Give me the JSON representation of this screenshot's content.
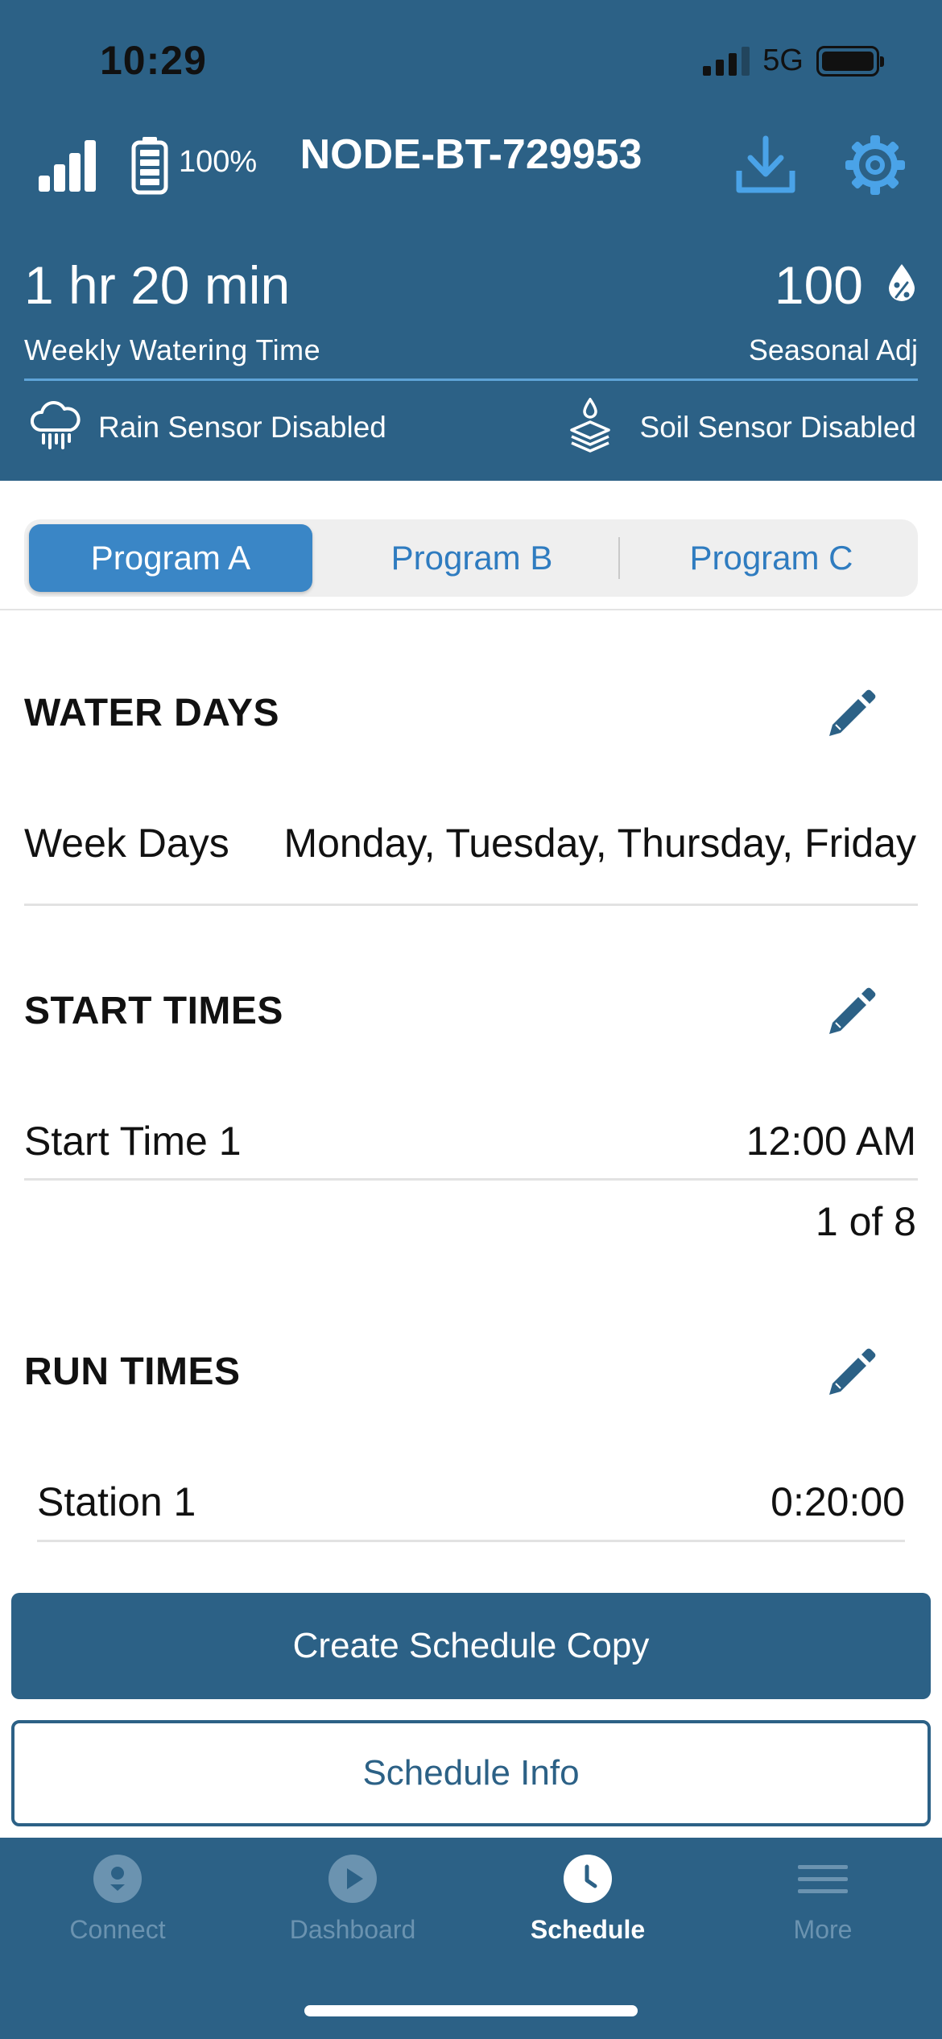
{
  "status_bar": {
    "time": "10:29",
    "network": "5G"
  },
  "header": {
    "device_name": "NODE-BT-729953",
    "battery_percent": "100%",
    "weekly_watering_time": "1 hr 20 min",
    "weekly_watering_label": "Weekly Watering Time",
    "seasonal_adj_value": "100",
    "seasonal_adj_label": "Seasonal Adj",
    "rain_sensor": "Rain Sensor Disabled",
    "soil_sensor": "Soil Sensor Disabled"
  },
  "programs": {
    "tabs": [
      "Program A",
      "Program B",
      "Program C"
    ],
    "selected": "Program A"
  },
  "water_days": {
    "title": "WATER DAYS",
    "label": "Week Days",
    "value": "Monday, Tuesday, Thursday, Friday"
  },
  "start_times": {
    "title": "START TIMES",
    "items": [
      {
        "label": "Start Time 1",
        "value": "12:00 AM"
      }
    ],
    "count": "1 of 8"
  },
  "run_times": {
    "title": "RUN TIMES",
    "items": [
      {
        "label": "Station 1",
        "value": "0:20:00"
      }
    ]
  },
  "actions": {
    "copy_label": "Create Schedule Copy",
    "info_label": "Schedule Info"
  },
  "nav": {
    "items": [
      {
        "label": "Connect",
        "icon": "connect-icon"
      },
      {
        "label": "Dashboard",
        "icon": "play-icon"
      },
      {
        "label": "Schedule",
        "icon": "clock-icon"
      },
      {
        "label": "More",
        "icon": "menu-icon"
      }
    ],
    "active": "Schedule"
  },
  "colors": {
    "header_bg": "#2c6186",
    "accent_blue": "#3a86c6",
    "link_blue": "#2f7cc0",
    "divider_blue": "#5fa4d8",
    "nav_inactive": "#6b93b0"
  }
}
